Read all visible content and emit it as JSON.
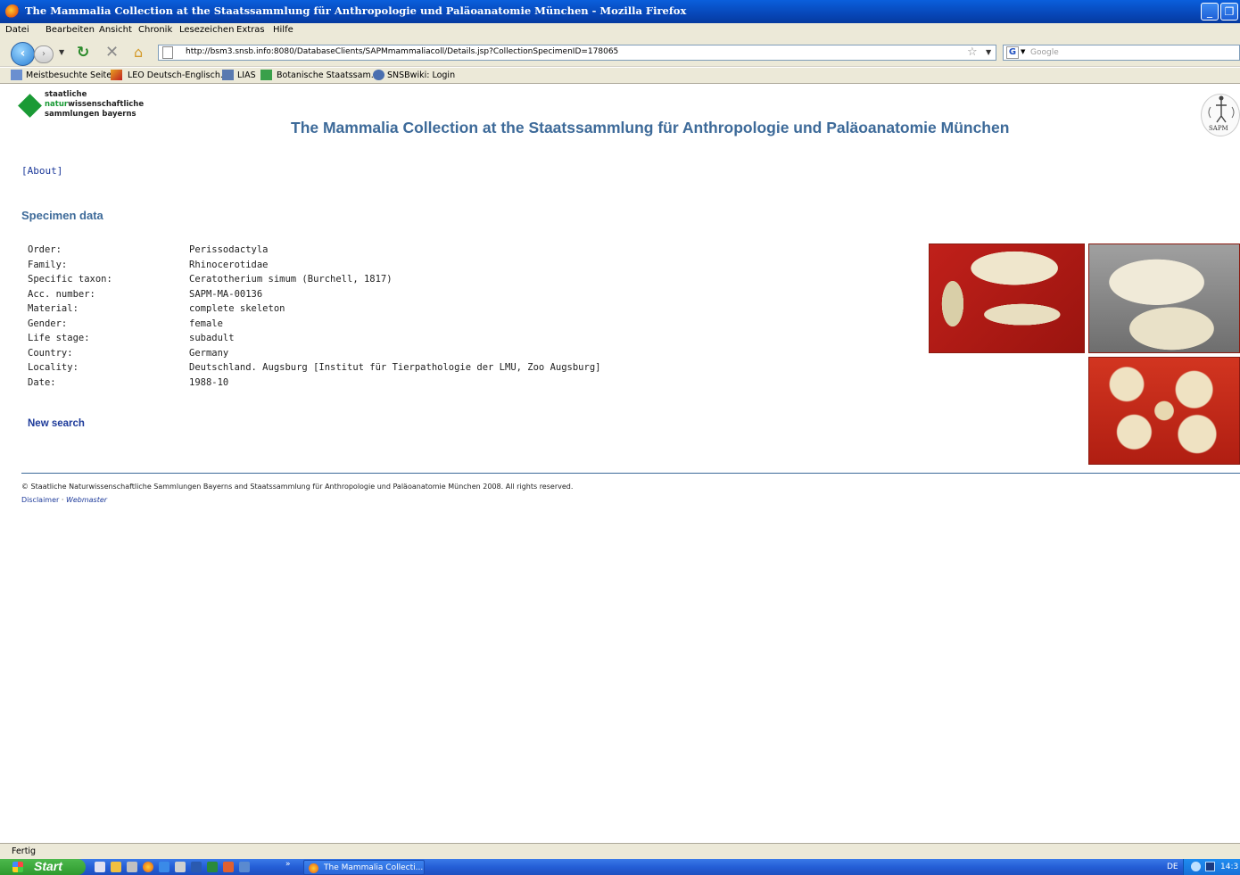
{
  "window": {
    "title": "The Mammalia Collection at the Staatssammlung für Anthropologie und Paläoanatomie München - Mozilla Firefox"
  },
  "menu": [
    "Datei",
    "Bearbeiten",
    "Ansicht",
    "Chronik",
    "Lesezeichen",
    "Extras",
    "Hilfe"
  ],
  "navigation": {
    "url": "http://bsm3.snsb.info:8080/DatabaseClients/SAPMmammaliacoll/Details.jsp?CollectionSpecimenID=178065",
    "search_placeholder": "Google"
  },
  "bookmarks": [
    "Meistbesuchte Seiten",
    "LEO Deutsch-Englisch...",
    "LIAS",
    "Botanische Staatssam...",
    "SNSBwiki: Login"
  ],
  "page": {
    "logo_lines": [
      "staatliche",
      "natur",
      "wissenschaftliche",
      "sammlungen bayerns"
    ],
    "sapm_label": "SAPM",
    "title": "The Mammalia Collection at the Staatssammlung für Anthropologie und Paläoanatomie München",
    "about_link": "[About]",
    "section_title": "Specimen data",
    "specimen": [
      {
        "label": "Order:",
        "value": "Perissodactyla"
      },
      {
        "label": "Family:",
        "value": "Rhinocerotidae"
      },
      {
        "label": "Specific taxon:",
        "value": "Ceratotherium simum (Burchell, 1817)"
      },
      {
        "label": "Acc. number:",
        "value": "SAPM-MA-00136"
      },
      {
        "label": "Material:",
        "value": "complete skeleton"
      },
      {
        "label": "Gender:",
        "value": "female"
      },
      {
        "label": "Life stage:",
        "value": "subadult"
      },
      {
        "label": "Country:",
        "value": "Germany"
      },
      {
        "label": "Locality:",
        "value": "Deutschland. Augsburg [Institut für Tierpathologie der LMU, Zoo Augsburg]"
      },
      {
        "label": "Date:",
        "value": "1988-10"
      }
    ],
    "new_search": "New search",
    "copyright": "© Staatliche Naturwissenschaftliche Sammlungen Bayerns and Staatssammlung für Anthropologie und Paläoanatomie München 2008. All rights reserved.",
    "disclaimer": "Disclaimer",
    "separator": "·",
    "webmaster": "Webmaster"
  },
  "status": "Fertig",
  "taskbar": {
    "start": "Start",
    "task": "The Mammalia Collecti...",
    "lang": "DE",
    "clock": "14:3"
  },
  "colors": {
    "accent": "#3d6a99",
    "link": "#1d3a9a",
    "logo_green": "#1a9a35"
  }
}
